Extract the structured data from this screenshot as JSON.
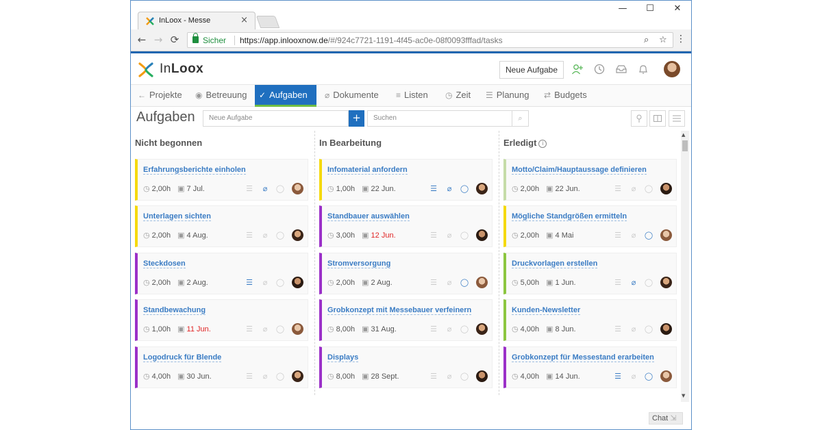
{
  "browser": {
    "tab_title": "InLoox - Messe",
    "tab_close": "×",
    "minimize": "—",
    "maximize": "☐",
    "close": "✕",
    "back": "←",
    "forward": "→",
    "reload": "⟳",
    "secure_label": "Sicher",
    "url_host": "https://app.inlooxnow.de",
    "url_rest": "/#/924c7721-1191-4f45-ac0e-08f0093fffad/tasks",
    "zoom_icon": "⌕",
    "star_icon": "☆",
    "menu_icon": "⋮"
  },
  "app": {
    "brand_light": "In",
    "brand_bold": "Loox",
    "new_task_button": "Neue Aufgabe",
    "icons": {
      "add_user": "+",
      "history": "↺",
      "inbox": "▭",
      "bell": "♪"
    }
  },
  "nav": [
    {
      "icon": "←",
      "label": "Projekte"
    },
    {
      "icon": "◉",
      "label": "Betreuung"
    },
    {
      "icon": "✓",
      "label": "Aufgaben"
    },
    {
      "icon": "⌀",
      "label": "Dokumente"
    },
    {
      "icon": "≡",
      "label": "Listen"
    },
    {
      "icon": "◷",
      "label": "Zeit"
    },
    {
      "icon": "☰",
      "label": "Planung"
    },
    {
      "icon": "⇄",
      "label": "Budgets"
    }
  ],
  "toolbar": {
    "title": "Aufgaben",
    "new_task_placeholder": "Neue Aufgabe",
    "add_label": "+",
    "search_placeholder": "Suchen",
    "search_icon": "⌕",
    "view_icons": [
      "♀",
      "◫",
      "≡"
    ]
  },
  "columns": [
    {
      "title": "Nicht begonnen",
      "cards": [
        {
          "title": "Erfahrungsberichte einholen",
          "hours": "2,00h",
          "date": "7 Jul.",
          "overdue": false,
          "color": "#f5d90a",
          "checklist": false,
          "attachment": true,
          "comment": false
        },
        {
          "title": "Unterlagen sichten",
          "hours": "2,00h",
          "date": "4 Aug.",
          "overdue": false,
          "color": "#f5d90a",
          "checklist": false,
          "attachment": false,
          "comment": false
        },
        {
          "title": "Steckdosen",
          "hours": "2,00h",
          "date": "2 Aug.",
          "overdue": false,
          "color": "#9b30c8",
          "checklist": true,
          "attachment": false,
          "comment": false
        },
        {
          "title": "Standbewachung",
          "hours": "1,00h",
          "date": "11 Jun.",
          "overdue": true,
          "color": "#9b30c8",
          "checklist": false,
          "attachment": false,
          "comment": false
        },
        {
          "title": "Logodruck für Blende",
          "hours": "4,00h",
          "date": "30 Jun.",
          "overdue": false,
          "color": "#9b30c8",
          "checklist": false,
          "attachment": false,
          "comment": false
        }
      ]
    },
    {
      "title": "In Bearbeitung",
      "cards": [
        {
          "title": "Infomaterial anfordern",
          "hours": "1,00h",
          "date": "22 Jun.",
          "overdue": false,
          "color": "#f5d90a",
          "checklist": true,
          "attachment": true,
          "comment": true
        },
        {
          "title": "Standbauer auswählen",
          "hours": "3,00h",
          "date": "12 Jun.",
          "overdue": true,
          "color": "#9b30c8",
          "checklist": false,
          "attachment": false,
          "comment": false
        },
        {
          "title": "Stromversorgung",
          "hours": "2,00h",
          "date": "2 Aug.",
          "overdue": false,
          "color": "#9b30c8",
          "checklist": false,
          "attachment": false,
          "comment": true
        },
        {
          "title": "Grobkonzept mit Messebauer verfeinern",
          "hours": "8,00h",
          "date": "31 Aug.",
          "overdue": false,
          "color": "#9b30c8",
          "checklist": false,
          "attachment": false,
          "comment": false
        },
        {
          "title": "Displays",
          "hours": "8,00h",
          "date": "28 Sept.",
          "overdue": false,
          "color": "#9b30c8",
          "checklist": false,
          "attachment": false,
          "comment": false
        }
      ]
    },
    {
      "title": "Erledigt",
      "info": "i",
      "cards": [
        {
          "title": "Motto/Claim/Hauptaussage definieren",
          "hours": "2,00h",
          "date": "22 Jun.",
          "overdue": false,
          "color": "#c5dca8",
          "checklist": false,
          "attachment": false,
          "comment": false
        },
        {
          "title": "Mögliche Standgrößen ermitteln",
          "hours": "2,00h",
          "date": "4 Mai",
          "overdue": false,
          "color": "#f5d90a",
          "checklist": false,
          "attachment": false,
          "comment": true
        },
        {
          "title": "Druckvorlagen erstellen",
          "hours": "5,00h",
          "date": "1 Jun.",
          "overdue": false,
          "color": "#8cc63f",
          "checklist": false,
          "attachment": true,
          "comment": false
        },
        {
          "title": "Kunden-Newsletter",
          "hours": "4,00h",
          "date": "8 Jun.",
          "overdue": false,
          "color": "#8cc63f",
          "checklist": false,
          "attachment": false,
          "comment": false
        },
        {
          "title": "Grobkonzept für Messestand erarbeiten",
          "hours": "4,00h",
          "date": "14 Jun.",
          "overdue": false,
          "color": "#9b30c8",
          "checklist": true,
          "attachment": false,
          "comment": true
        }
      ]
    }
  ],
  "chat_label": "Chat",
  "chat_icon": "⇲",
  "card_icons": {
    "clock": "◷",
    "calendar": "▣",
    "checklist": "☰",
    "attachment": "⌀",
    "comment": "◯"
  },
  "colors": {
    "accent": "#1f6fbf",
    "active_underline": "#6fbe44",
    "link": "#3a7cc4",
    "overdue": "#e02424"
  }
}
